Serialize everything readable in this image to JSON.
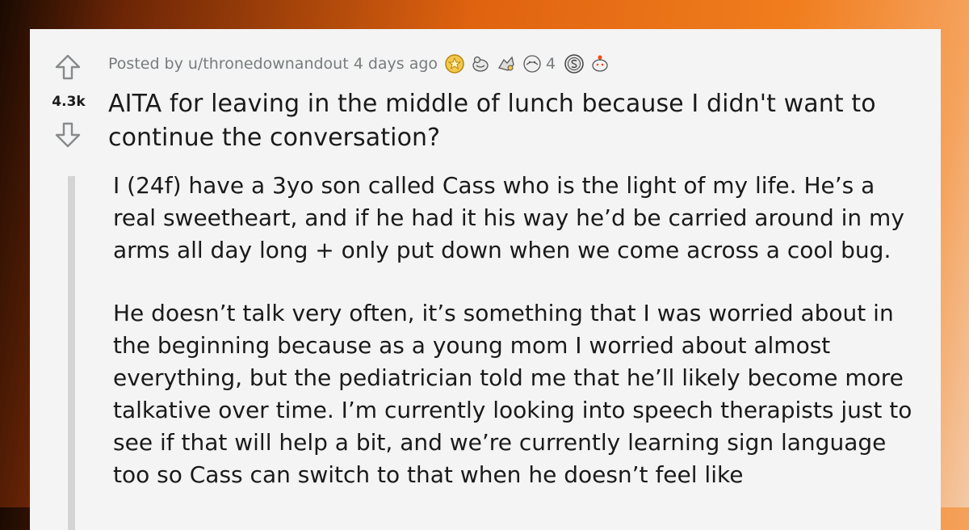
{
  "post": {
    "posted_by_prefix": "Posted by",
    "author": "u/thronedownandout",
    "time_ago": "4 days ago",
    "vote_count": "4.3k",
    "awards": {
      "icons": [
        "gold-award-icon",
        "wholesome-award-icon",
        "helpful-award-icon",
        "hugz-award-icon",
        "silver-award-icon",
        "take-my-energy-award-icon"
      ],
      "hugz_count": "4"
    },
    "title": "AITA for leaving in the middle of lunch because I didn't want to continue the conversation?",
    "body": [
      "I (24f) have a 3yo son called Cass who is the light of my life. He’s a real sweetheart, and if he had it his way he’d be carried around in my arms all day long + only put down when we come across a cool bug.",
      "He doesn’t talk very often, it’s something that I was worried about in the beginning because as a young mom I worried about almost everything, but the pediatrician told me that he’ll likely become more talkative over time. I’m currently looking into speech therapists just to see if that will help a bit, and we’re currently learning sign language too so Cass can switch to that when he doesn’t feel like"
    ]
  },
  "colors": {
    "card_bg": "#f4f4f4",
    "text": "#1a1a1b",
    "meta": "#787c7e",
    "quote_bar": "#d4d4d4"
  }
}
